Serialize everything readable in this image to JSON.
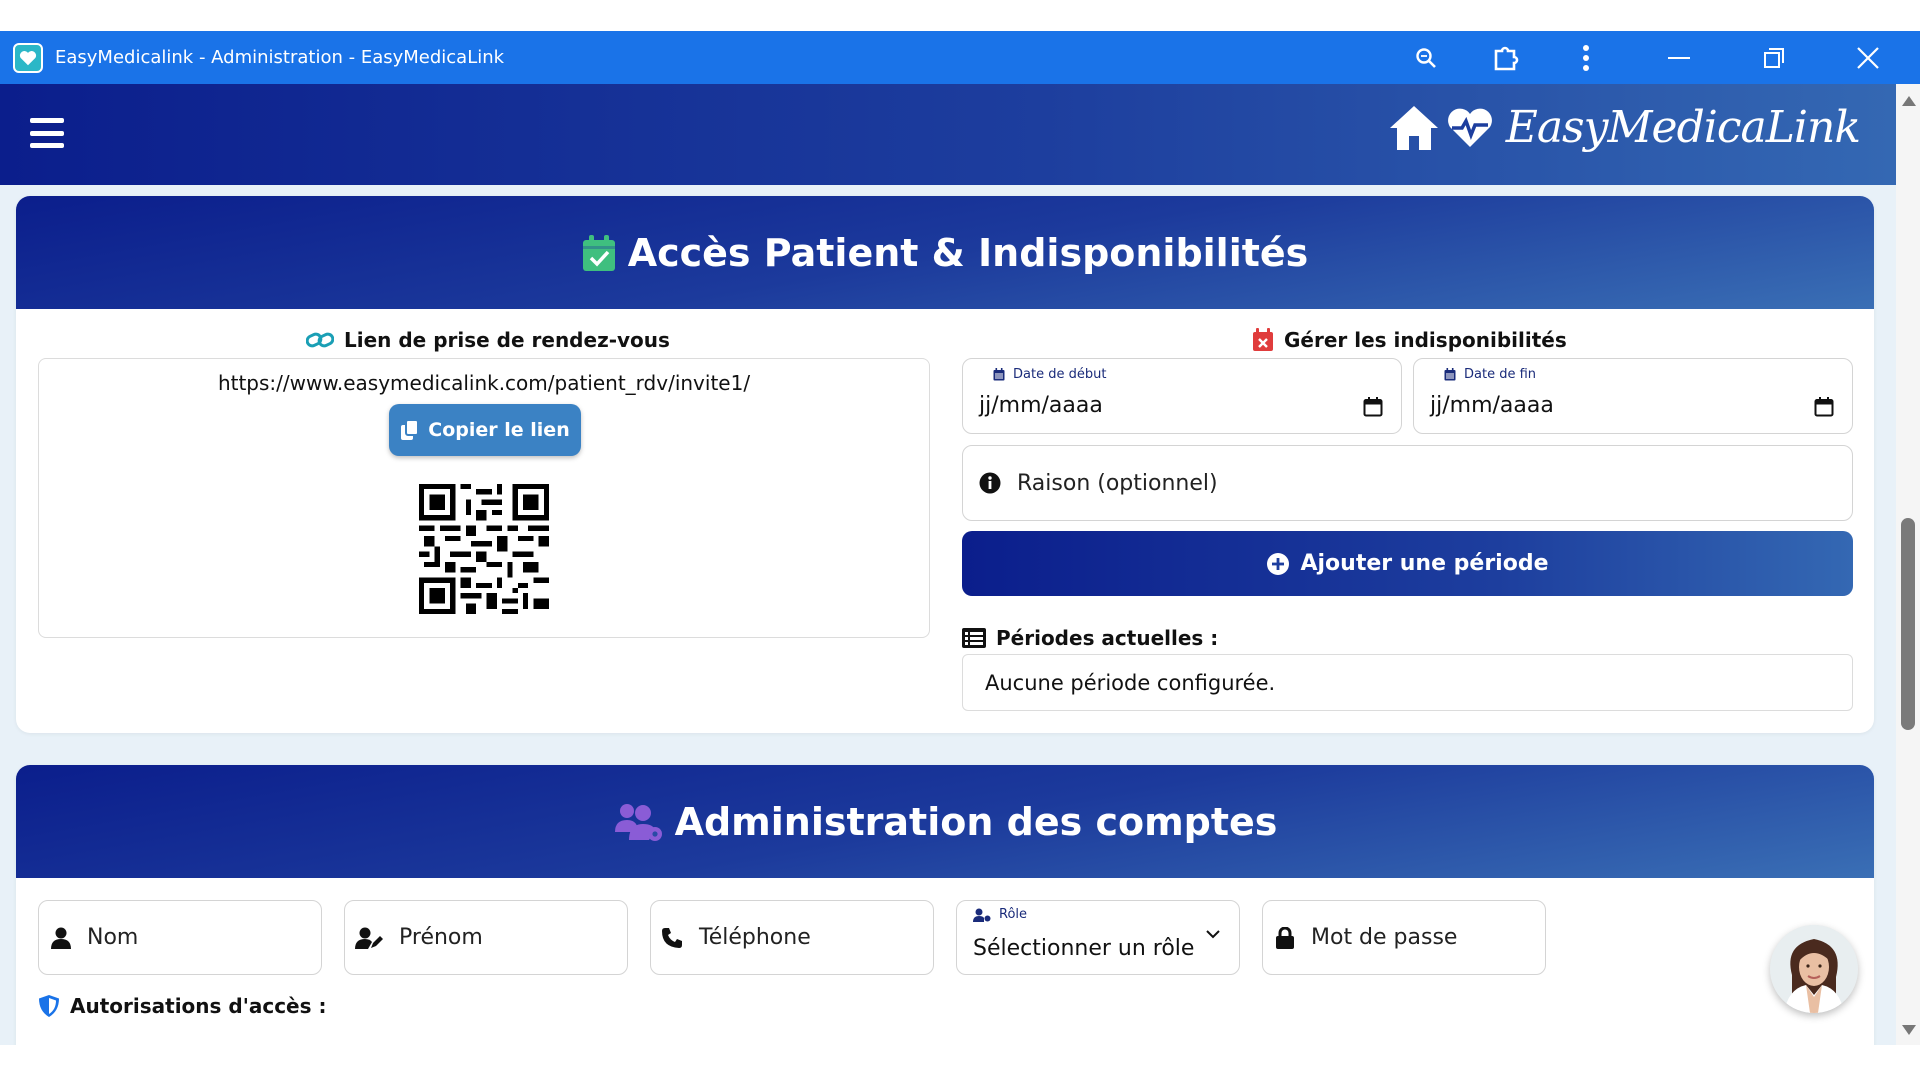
{
  "window": {
    "title": "EasyMedicalink - Administration - EasyMedicaLink",
    "icons": [
      "search-icon",
      "extension-icon",
      "more-vert-icon",
      "minimize-icon",
      "restore-icon",
      "close-icon"
    ]
  },
  "header": {
    "brand_name": "EasyMedicaLink",
    "icons": [
      "hamburger-icon",
      "home-icon",
      "heart-pulse-icon"
    ]
  },
  "patient_access": {
    "title": "Accès Patient & Indisponibilités",
    "title_icon": "calendar-check-icon",
    "link_section": {
      "label": "Lien de prise de rendez-vous",
      "link_url": "https://www.easymedicalink.com/patient_rdv/invite1/",
      "copy_button": "Copier le lien"
    },
    "unavailability_section": {
      "label": "Gérer les indisponibilités",
      "start_date": {
        "label": "Date de début",
        "placeholder": "jj/mm/aaaa"
      },
      "end_date": {
        "label": "Date de fin",
        "placeholder": "jj/mm/aaaa"
      },
      "reason": {
        "placeholder": "Raison (optionnel)"
      },
      "add_button": "Ajouter une période",
      "current_periods_label": "Périodes actuelles :",
      "current_periods_empty": "Aucune période configurée."
    }
  },
  "accounts": {
    "title": "Administration des comptes",
    "title_icon": "users-cog-icon",
    "fields": {
      "last_name": "Nom",
      "first_name": "Prénom",
      "phone": "Téléphone",
      "role_label": "Rôle",
      "role_value": "Sélectionner un rôle",
      "password": "Mot de passe"
    },
    "permissions_label": "Autorisations d'accès :"
  },
  "colors": {
    "titlebar": "#1a73e8",
    "header_dark": "#0b1e8c",
    "header_light": "#3468b3",
    "copy_button": "#3b82c4",
    "page_bg": "#e8f1f8",
    "calendar_icon_green": "#3fbf7f",
    "calendar_icon_red": "#e03c3c",
    "link_icon_teal": "#1a9fb5",
    "users_icon_purple": "#8a5cd6"
  }
}
